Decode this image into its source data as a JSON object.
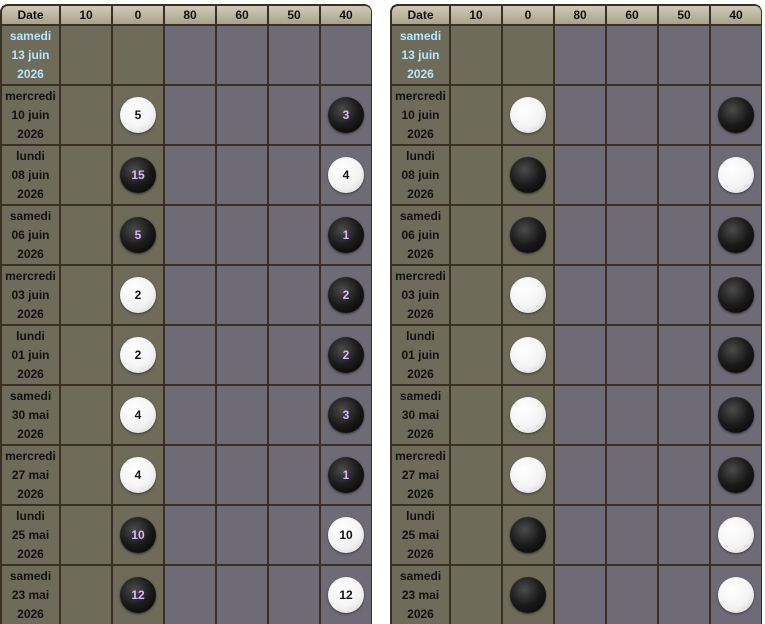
{
  "headers": [
    "Date",
    "10",
    "0",
    "80",
    "60",
    "50",
    "40"
  ],
  "rows": [
    {
      "day": "samedi",
      "num": "13 juin",
      "year": "2026",
      "today": true,
      "left": [],
      "right": []
    },
    {
      "day": "mercredi",
      "num": "10 juin",
      "year": "2026",
      "left": [
        {
          "col": 2,
          "color": "white",
          "n": "5"
        },
        {
          "col": 6,
          "color": "black",
          "n": "3"
        }
      ],
      "right": [
        {
          "col": 2,
          "color": "white"
        },
        {
          "col": 6,
          "color": "black"
        }
      ]
    },
    {
      "day": "lundi",
      "num": "08 juin",
      "year": "2026",
      "left": [
        {
          "col": 2,
          "color": "black",
          "n": "15"
        },
        {
          "col": 6,
          "color": "white",
          "n": "4"
        }
      ],
      "right": [
        {
          "col": 2,
          "color": "black"
        },
        {
          "col": 6,
          "color": "white"
        }
      ]
    },
    {
      "day": "samedi",
      "num": "06 juin",
      "year": "2026",
      "left": [
        {
          "col": 2,
          "color": "black",
          "n": "5"
        },
        {
          "col": 6,
          "color": "black",
          "n": "1"
        }
      ],
      "right": [
        {
          "col": 2,
          "color": "black"
        },
        {
          "col": 6,
          "color": "black"
        }
      ]
    },
    {
      "day": "mercredi",
      "num": "03 juin",
      "year": "2026",
      "left": [
        {
          "col": 2,
          "color": "white",
          "n": "2"
        },
        {
          "col": 6,
          "color": "black",
          "n": "2"
        }
      ],
      "right": [
        {
          "col": 2,
          "color": "white"
        },
        {
          "col": 6,
          "color": "black"
        }
      ]
    },
    {
      "day": "lundi",
      "num": "01 juin",
      "year": "2026",
      "left": [
        {
          "col": 2,
          "color": "white",
          "n": "2"
        },
        {
          "col": 6,
          "color": "black",
          "n": "2"
        }
      ],
      "right": [
        {
          "col": 2,
          "color": "white"
        },
        {
          "col": 6,
          "color": "black"
        }
      ]
    },
    {
      "day": "samedi",
      "num": "30 mai",
      "year": "2026",
      "left": [
        {
          "col": 2,
          "color": "white",
          "n": "4"
        },
        {
          "col": 6,
          "color": "black",
          "n": "3"
        }
      ],
      "right": [
        {
          "col": 2,
          "color": "white"
        },
        {
          "col": 6,
          "color": "black"
        }
      ]
    },
    {
      "day": "mercredi",
      "num": "27 mai",
      "year": "2026",
      "left": [
        {
          "col": 2,
          "color": "white",
          "n": "4"
        },
        {
          "col": 6,
          "color": "black",
          "n": "1"
        }
      ],
      "right": [
        {
          "col": 2,
          "color": "white"
        },
        {
          "col": 6,
          "color": "black"
        }
      ]
    },
    {
      "day": "lundi",
      "num": "25 mai",
      "year": "2026",
      "left": [
        {
          "col": 2,
          "color": "black",
          "n": "10"
        },
        {
          "col": 6,
          "color": "white",
          "n": "10"
        }
      ],
      "right": [
        {
          "col": 2,
          "color": "black"
        },
        {
          "col": 6,
          "color": "white"
        }
      ]
    },
    {
      "day": "samedi",
      "num": "23 mai",
      "year": "2026",
      "left": [
        {
          "col": 2,
          "color": "black",
          "n": "12"
        },
        {
          "col": 6,
          "color": "white",
          "n": "12"
        }
      ],
      "right": [
        {
          "col": 2,
          "color": "black"
        },
        {
          "col": 6,
          "color": "white"
        }
      ]
    }
  ],
  "olive_columns": [
    0,
    1,
    2
  ],
  "colors": {
    "olive": "#6f6b5a",
    "grey": "#6e6b77",
    "frame": "#3a2f23",
    "today_text": "#b7e4ff",
    "black_stone_text": "#d9b8ff"
  }
}
